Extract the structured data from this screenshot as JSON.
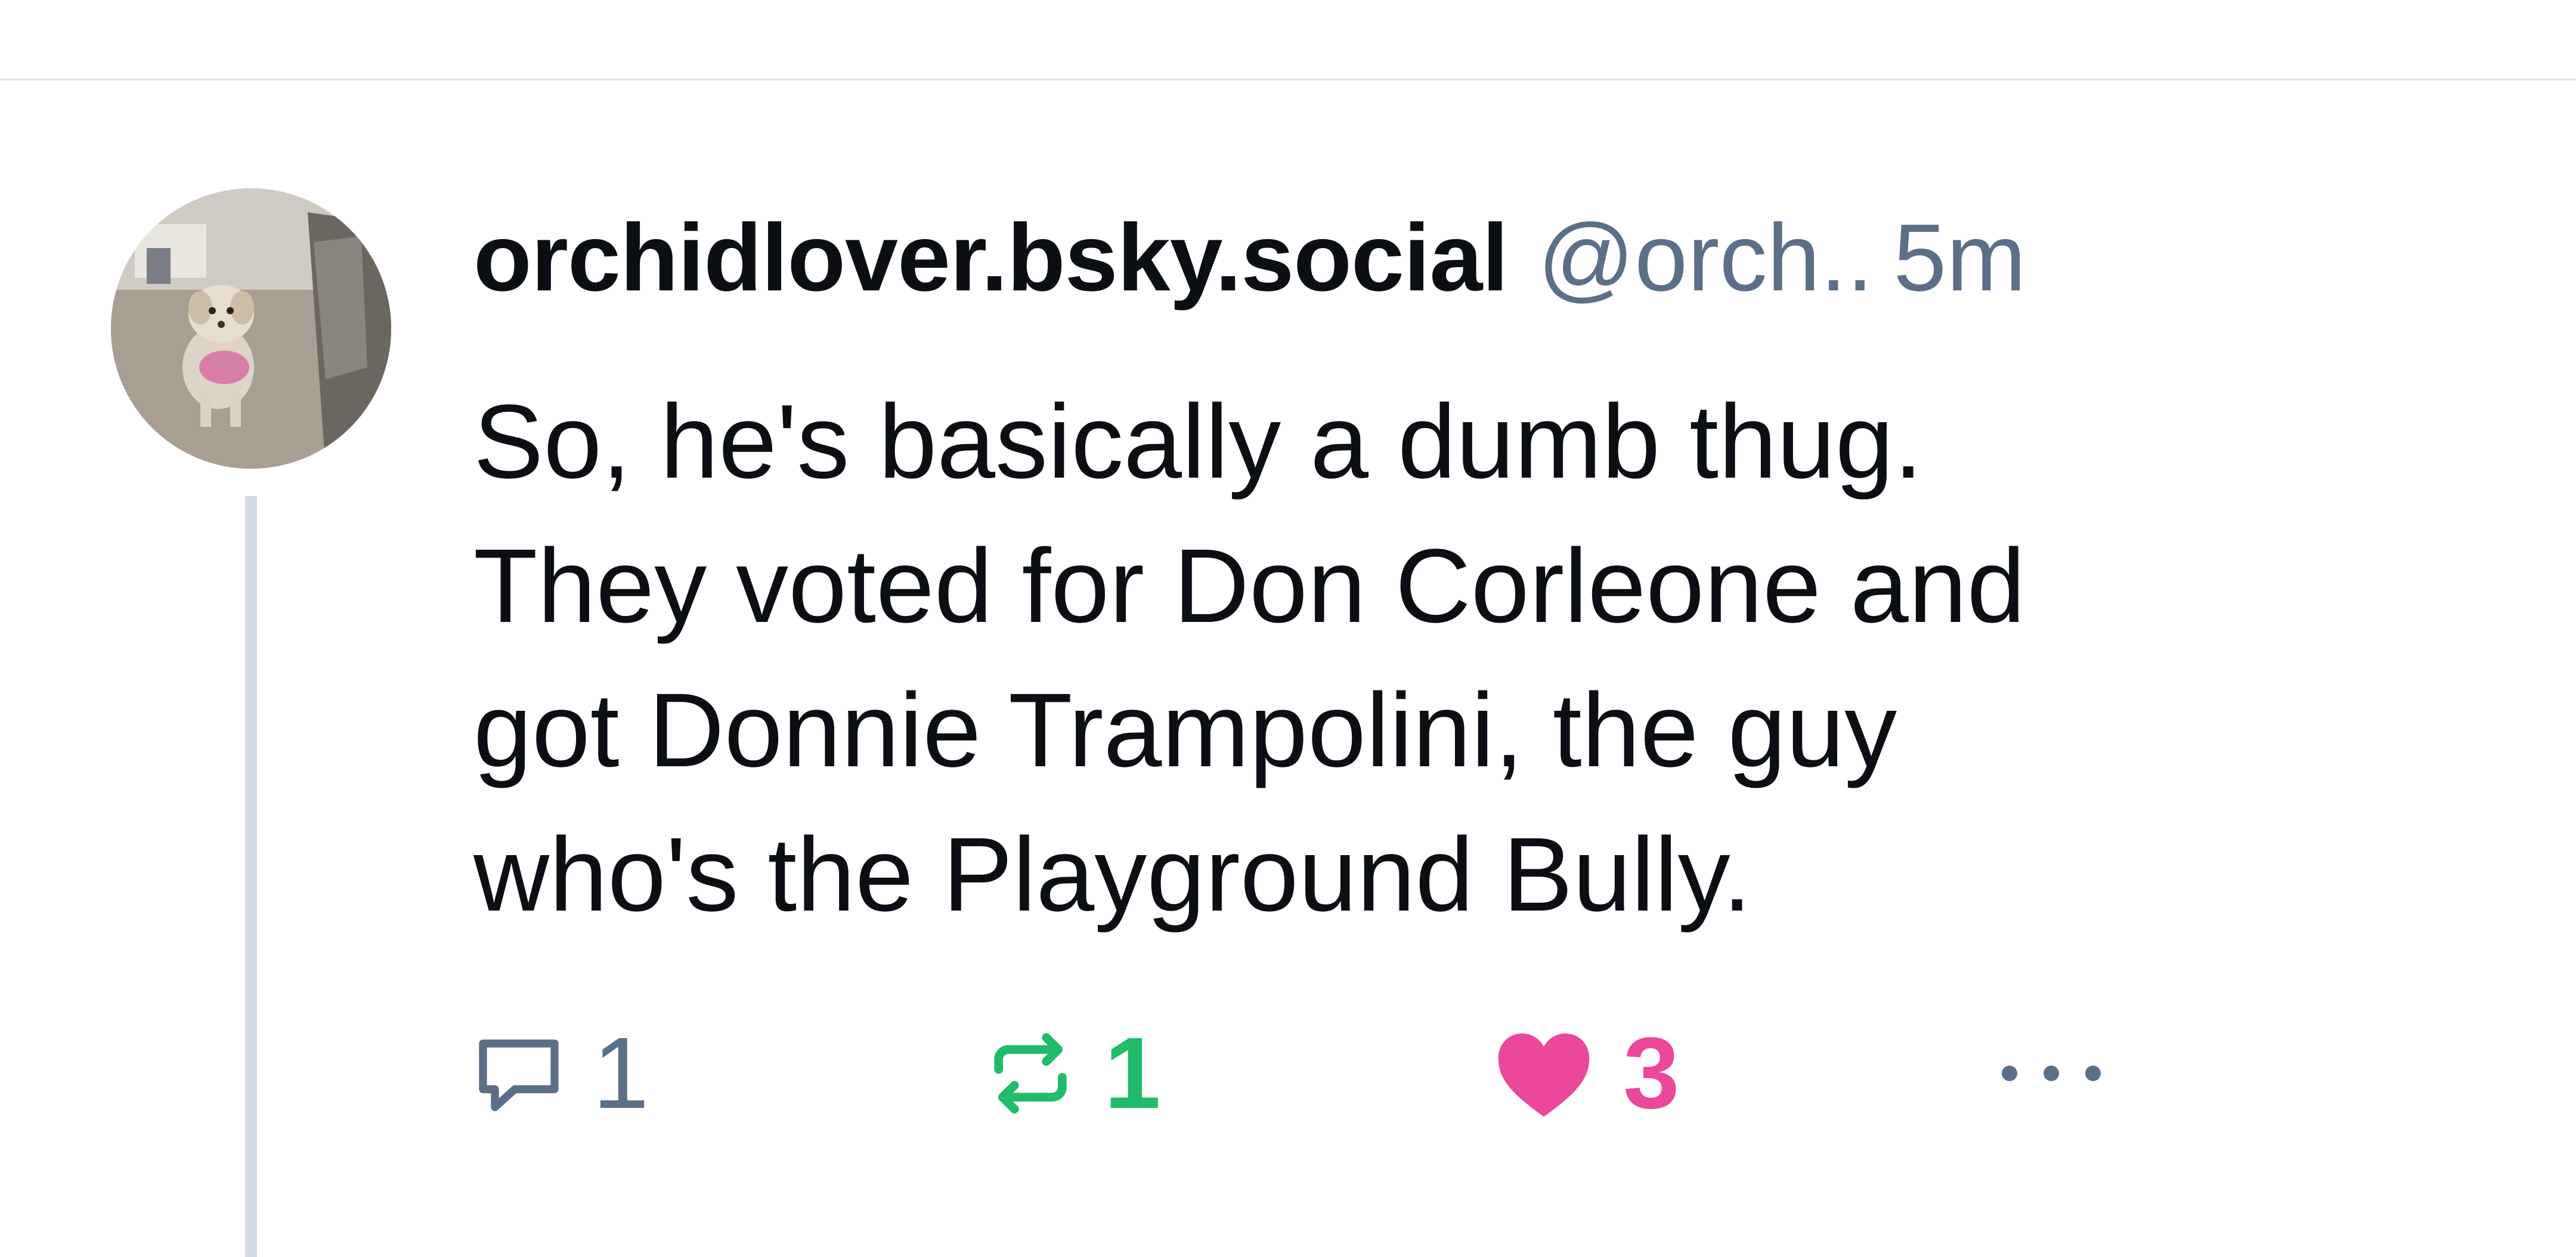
{
  "post": {
    "display_name": "orchidlover.bsky.social",
    "handle": "@orch..",
    "timestamp": "5m",
    "text_lines": [
      "So, he's basically a dumb thug.",
      "They voted for Don Corleone and",
      "got Donnie Trampolini, the guy",
      "who's the Playground Bully."
    ],
    "avatar": "dog-photo-avatar"
  },
  "actions": {
    "reply": {
      "icon": "reply-bubble-icon",
      "count": "1"
    },
    "repost": {
      "icon": "repost-icon",
      "count": "1",
      "color": "#20bc69"
    },
    "like": {
      "icon": "heart-icon",
      "count": "3",
      "color": "#ec4899"
    },
    "more": {
      "icon": "more-dots-icon"
    }
  },
  "colors": {
    "text": "#0b0f14",
    "muted": "#5b6f88",
    "thread_line": "#d5dbe6",
    "divider": "#dfe3e8"
  }
}
